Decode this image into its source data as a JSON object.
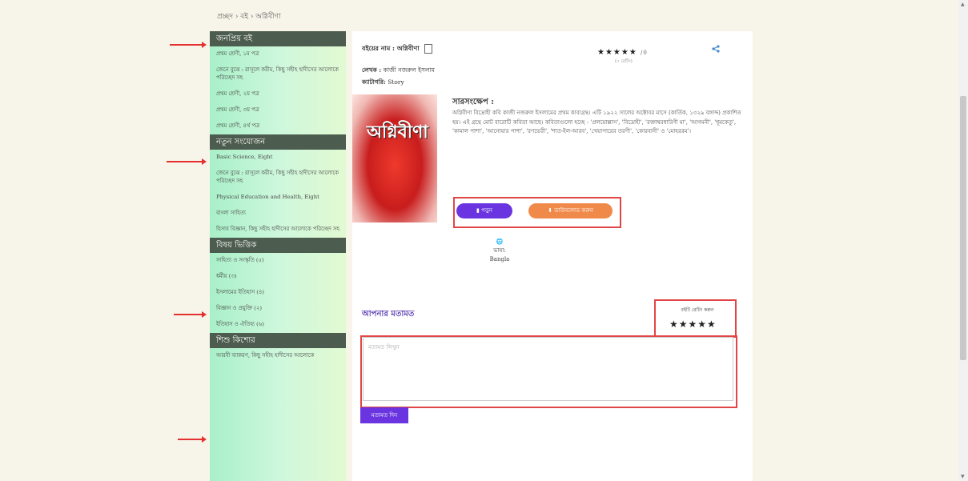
{
  "breadcrumb": "প্রচ্ছদ › বই › অগ্নিবীণা",
  "sidebar": {
    "sections": [
      {
        "heading": "জনপ্রিয় বই",
        "items": [
          "প্রথম শ্রেণী, ১ম পত্র",
          "জেনে বুঝে : রাসূলে করীম, কিছু সহীহ হাদীসের আলোকে পরিচ্ছেদ সহ",
          "প্রথম শ্রেণী, ২য় পত্র",
          "প্রথম শ্রেণী, ৩য় পত্র",
          "প্রথম শ্রেণী, ৪র্থ পত্র"
        ]
      },
      {
        "heading": "নতুন সংযোজন",
        "items": [
          "Basic Science, Eight",
          "জেনে বুঝে : রাসূলে করীম, কিছু সহীহ হাদীসের আলোকে পরিচ্ছেদ সহ",
          "Physical Education and Health, Eight",
          "বাংলা সাহিত্য",
          "হিসাব বিজ্ঞান, কিছু সহীহ হাদীসের আলোকে পরিচ্ছেদ সহ"
        ]
      },
      {
        "heading": "বিষয় ভিত্তিক",
        "items": [
          "সাহিত্য ও সংস্কৃতি (৫)",
          "ধর্মীয় (৩)",
          "ইসলামের ইতিহাস (৪)",
          "বিজ্ঞান ও প্রযুক্তি (২)",
          "ইতিহাস ও ঐতিহ্য (৬)"
        ]
      },
      {
        "heading": "শিশু কিশোর",
        "items": [
          "আরবী ব্যাকরণ, কিছু সহীহ হাদীসের আলোকে"
        ]
      }
    ]
  },
  "book": {
    "name_label": "বইয়ের নাম : অগ্নিবীণা",
    "author_label": "লেখক :",
    "author": "কাজী নজরুল ইসলাম",
    "category_label": "ক্যাটাগরি:",
    "category": "Story",
    "rating_stars": "★★★★★",
    "rating_count": "/0",
    "rating_sub": "(০ রেটিং)",
    "cover_text": "অগ্নিবীণা",
    "summary_title": "সারসংক্ষেপ :",
    "summary": "অগ্নিবীণা বিদ্রোহী কবি কাজী নজরুল ইসলামের প্রথম কাব্যগ্রন্থ। এটি ১৯২২ সালের অক্টোবর মাসে (কার্তিক, ১৩২৯ বঙ্গাব্দ) প্রকাশিত হয়। এই গ্রন্থে মোট বারোটি কবিতা আছে। কবিতাগুলো হচ্ছে - 'প্রলয়োল্লাস', 'বিদ্রোহী', 'রক্তাম্বরধারিণী মা', 'আগমনী', 'ধূমকেতু', 'কামাল পাশা', 'আনোয়ার পাশা', 'রণভেরী', 'শাত-ইল-আরব', 'খেয়াপারের তরণী', 'কোরবানী' ও 'মোহররম'।",
    "read_label": "পড়ুন",
    "download_label": "ডাউনলোড করুন",
    "lang_glyph": "🌐",
    "lang_label": "ভাষা:",
    "lang_value": "Bangla"
  },
  "feedback": {
    "title": "আপনার মতামত",
    "rate_label": "বইটি রেটিং করুন",
    "rate_stars": "★★★★★",
    "placeholder": "মতামত লিখুন",
    "submit_label": "মতামত দিন"
  }
}
